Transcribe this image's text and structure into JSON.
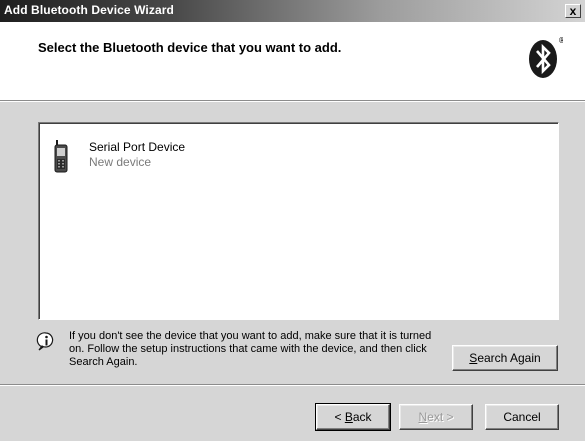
{
  "window": {
    "title": "Add Bluetooth Device Wizard",
    "close_label": "x"
  },
  "header": {
    "title": "Select the Bluetooth device that you want to add.",
    "logo_icon": "bluetooth-logo-icon",
    "logo_mark": "®"
  },
  "devices": [
    {
      "name": "Serial Port Device",
      "status": "New device",
      "icon": "phone-device-icon"
    }
  ],
  "info": {
    "icon": "info-icon",
    "text": "If you don't see the device that you want to add, make sure that it is turned on. Follow the setup instructions that came with the device, and then click Search Again."
  },
  "buttons": {
    "search_again": {
      "pre": "",
      "accel": "S",
      "post": "earch Again"
    },
    "back": {
      "pre": "< ",
      "accel": "B",
      "post": "ack"
    },
    "next": {
      "pre": "",
      "accel": "N",
      "post": "ext >"
    },
    "cancel": {
      "label": "Cancel"
    }
  },
  "colors": {
    "dialog_bg": "#d6d6d6",
    "header_bg": "#ffffff",
    "title_bar_start": "#1e1e1e",
    "title_bar_end": "#d4d4d4",
    "disabled_text": "#9a9a9a"
  }
}
